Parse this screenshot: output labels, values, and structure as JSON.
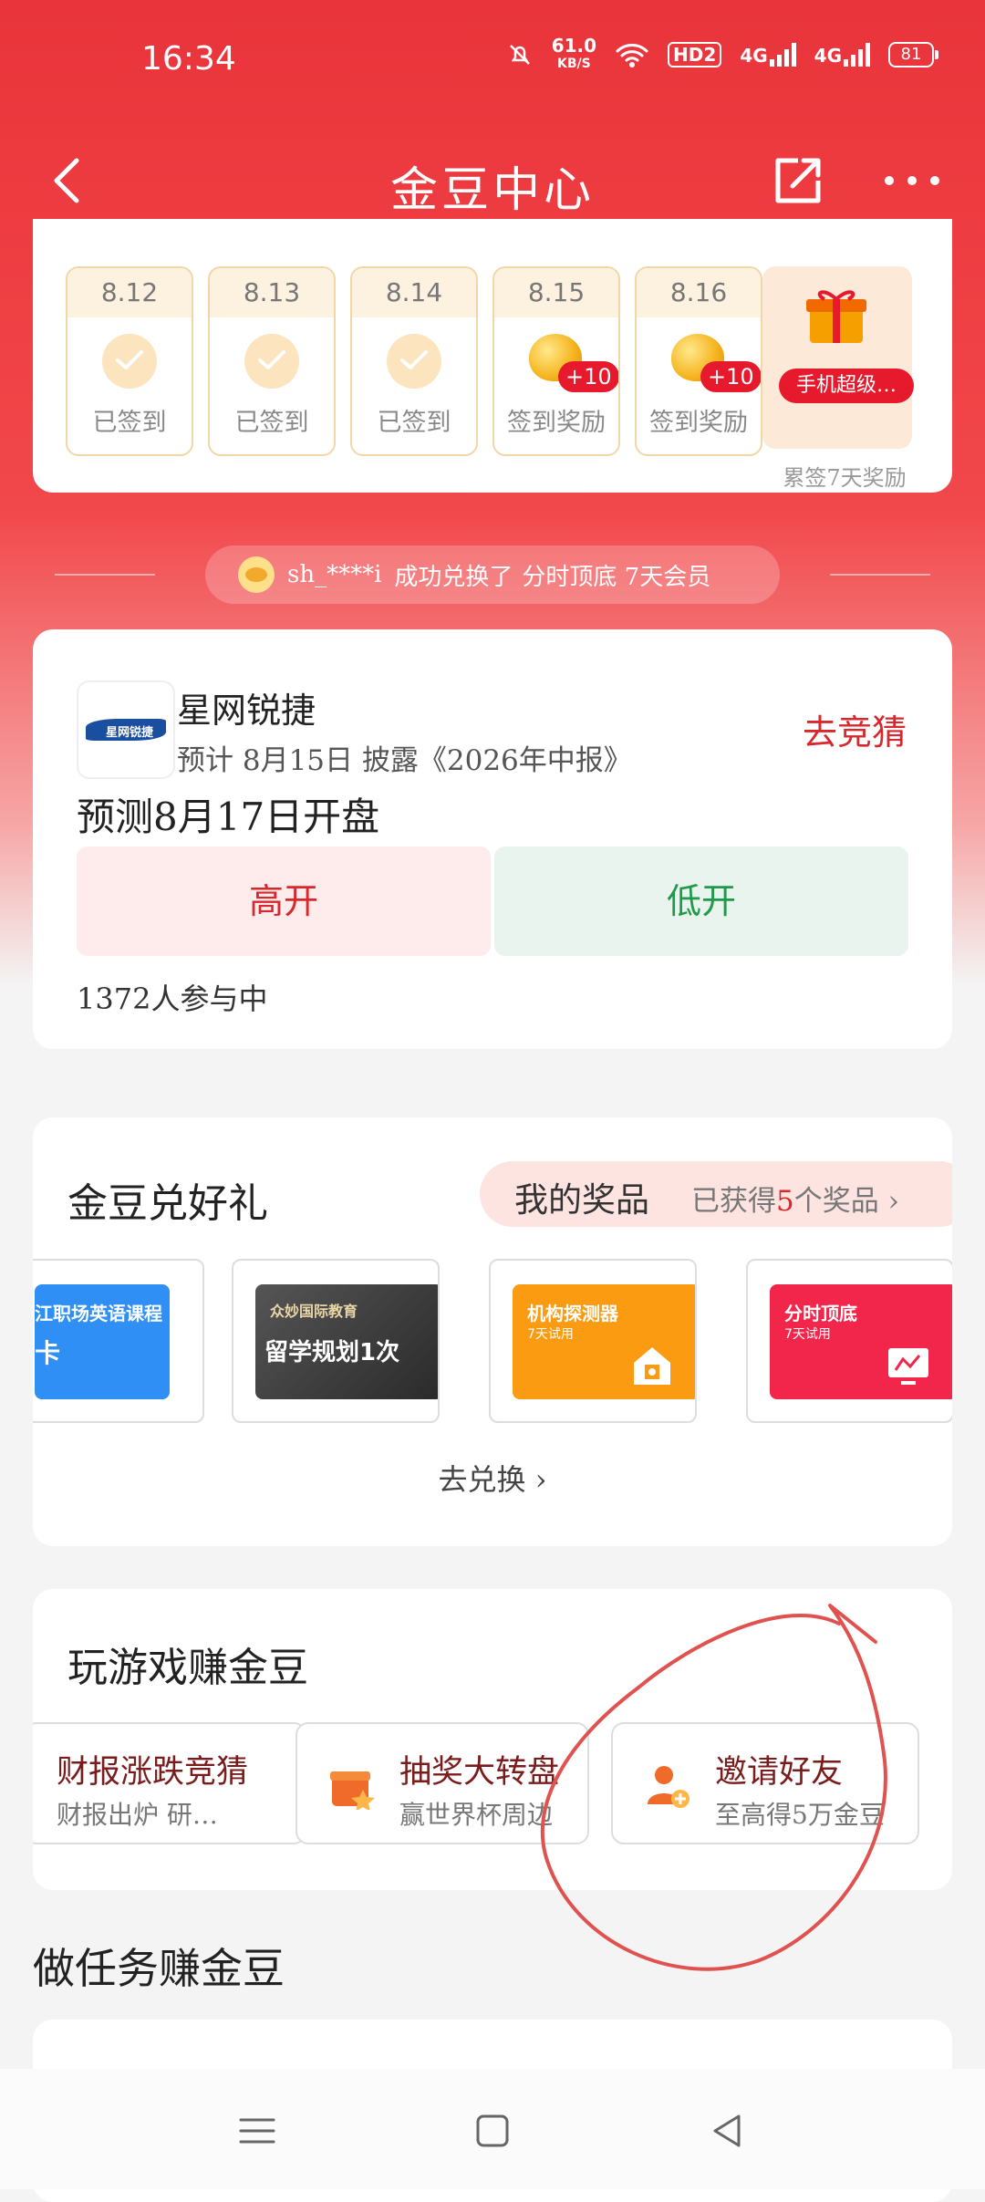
{
  "status_bar": {
    "time": "16:34",
    "net_speed_value": "61.0",
    "net_speed_unit": "KB/S",
    "hd_label": "HD2",
    "sim1": "4G",
    "sim2": "4G",
    "battery": "81"
  },
  "nav": {
    "title": "金豆中心"
  },
  "signin": {
    "days": [
      {
        "date": "8.12",
        "label": "已签到",
        "state": "done"
      },
      {
        "date": "8.13",
        "label": "已签到",
        "state": "done"
      },
      {
        "date": "8.14",
        "label": "已签到",
        "state": "done"
      },
      {
        "date": "8.15",
        "label": "签到奖励",
        "state": "reward",
        "reward": "+10"
      },
      {
        "date": "8.16",
        "label": "签到奖励",
        "state": "reward",
        "reward": "+10"
      }
    ],
    "day7": {
      "tag": "手机超级…",
      "label": "累签7天奖励"
    }
  },
  "ticker": {
    "user": "sh_****i",
    "action": "成功兑换了",
    "item": "分时顶底 7天会员"
  },
  "prediction": {
    "company": "星网锐捷",
    "logo_text": "星网锐捷",
    "disclose": "预计 8月15日 披露《2026年中报》",
    "guess_label": "去竞猜",
    "question": "预测8月17日开盘",
    "option_high": "高开",
    "option_low": "低开",
    "participants": "1372人参与中"
  },
  "redeem": {
    "title": "金豆兑好礼",
    "my_prizes": "我的奖品",
    "got_prefix": "已获得",
    "got_count": "5",
    "got_suffix": "个奖品",
    "cards": [
      {
        "line1": "江职场英语课程",
        "line2": "",
        "big": "卡",
        "color": "#2f8ff5"
      },
      {
        "line1": "众妙国际教育",
        "line2": "",
        "big": "留学规划1次",
        "color": "#3a3a3a"
      },
      {
        "line1": "机构探测器",
        "line2": "7天试用",
        "big": "",
        "color": "#fb9b12"
      },
      {
        "line1": "分时顶底",
        "line2": "7天试用",
        "big": "",
        "color": "#f2254a"
      }
    ],
    "go_label": "去兑换"
  },
  "games": {
    "title": "玩游戏赚金豆",
    "items": [
      {
        "title": "财报涨跌竞猜",
        "sub": "财报出炉 研…"
      },
      {
        "title": "抽奖大转盘",
        "sub": "赢世界杯周边"
      },
      {
        "title": "邀请好友",
        "sub": "至高得5万金豆"
      }
    ]
  },
  "tasks": {
    "title": "做任务赚金豆"
  },
  "colors": {
    "brand_red": "#e8343a",
    "accent_red": "#d8282e",
    "green": "#1f9a4a"
  }
}
